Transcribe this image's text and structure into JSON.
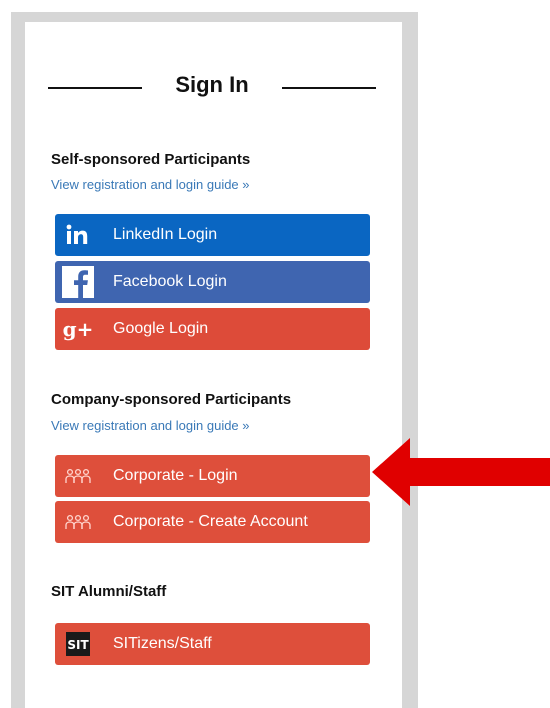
{
  "title": "Sign In",
  "self": {
    "heading": "Self-sponsored Participants",
    "guide": "View registration and login guide »",
    "buttons": {
      "linkedin": "LinkedIn Login",
      "facebook": "Facebook Login",
      "google": "Google Login"
    }
  },
  "company": {
    "heading": "Company-sponsored Participants",
    "guide": "View registration and login guide »",
    "buttons": {
      "login": "Corporate - Login",
      "create": "Corporate - Create Account"
    }
  },
  "alumni": {
    "heading": "SIT Alumni/Staff",
    "button": "SITizens/Staff"
  },
  "icons": {
    "linkedin": "linkedin-icon",
    "facebook": "facebook-icon",
    "google": "google-plus-icon",
    "corporate": "group-icon",
    "sit": "sit-logo-icon"
  },
  "colors": {
    "linkedin": "#0a66c2",
    "facebook": "#3f65b0",
    "google": "#dd4b39",
    "corporate": "#de4f3b",
    "arrow": "#e00000",
    "link": "#3a79b7"
  }
}
